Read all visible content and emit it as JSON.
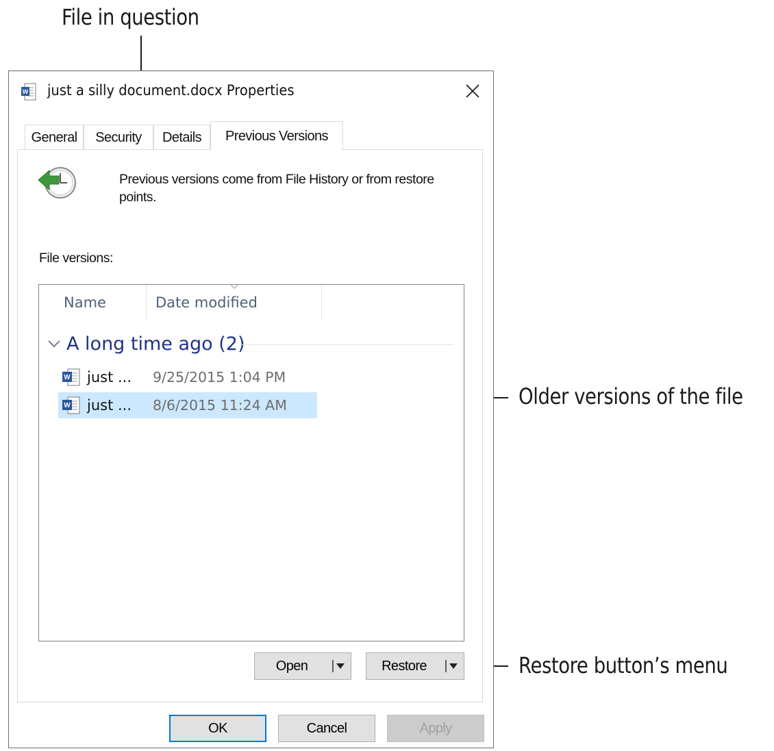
{
  "annotations": {
    "file_in_question": "File in question",
    "older_versions": "Older versions of the file",
    "restore_menu": "Restore button’s menu"
  },
  "dialog": {
    "title": "just a silly document.docx Properties",
    "title_icon": "word-document-icon",
    "close_icon": "close-icon"
  },
  "tabs": [
    {
      "label": "General",
      "active": false
    },
    {
      "label": "Security",
      "active": false
    },
    {
      "label": "Details",
      "active": false
    },
    {
      "label": "Previous Versions",
      "active": true
    }
  ],
  "panel": {
    "info_text": "Previous versions come from File History or from restore points.",
    "info_icon": "previous-versions-clock-icon",
    "versions_label": "File versions:",
    "columns": [
      "Name",
      "Date modified"
    ],
    "group": {
      "label": "A long time ago (2)"
    },
    "rows": [
      {
        "name": "just ...",
        "date": "9/25/2015 1:04 PM",
        "selected": false
      },
      {
        "name": "just ...",
        "date": "8/6/2015 11:24 AM",
        "selected": true
      }
    ],
    "open_label": "Open",
    "restore_label": "Restore"
  },
  "footer": {
    "ok_label": "OK",
    "cancel_label": "Cancel",
    "apply_label": "Apply"
  },
  "colors": {
    "selection": "#cce8ff",
    "group_header": "#1e3287",
    "column_header": "#4c607a",
    "default_button_border": "#0078d7"
  }
}
